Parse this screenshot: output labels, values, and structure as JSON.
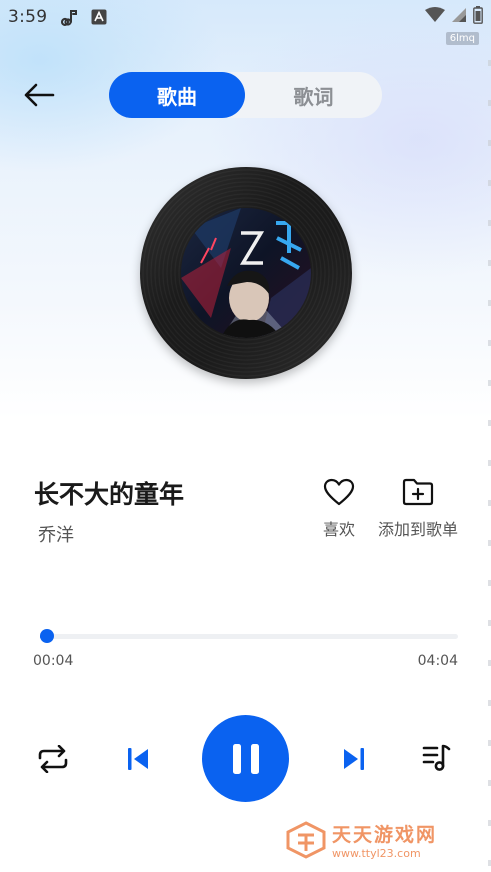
{
  "status_bar": {
    "time": "3:59",
    "icons": [
      "music-note-icon",
      "font-a-icon"
    ],
    "right_icons": [
      "wifi-icon",
      "signal-icon",
      "battery-icon"
    ],
    "net_badge": "6lmq"
  },
  "header": {
    "back_icon": "arrow-left-icon",
    "tabs": [
      {
        "label": "歌曲",
        "active": true
      },
      {
        "label": "歌词",
        "active": false
      }
    ]
  },
  "disc": {
    "cover_icon": "album-cover-image"
  },
  "song": {
    "title": "长不大的童年",
    "artist": "乔洋"
  },
  "actions": {
    "like_label": "喜欢",
    "add_label": "添加到歌单"
  },
  "progress": {
    "current": "00:04",
    "total": "04:04",
    "fraction": 0.016
  },
  "controls": {
    "repeat_icon": "repeat-icon",
    "prev_icon": "skip-previous-icon",
    "play_state": "playing",
    "next_icon": "skip-next-icon",
    "playlist_icon": "playlist-icon"
  },
  "colors": {
    "accent": "#0a62f0"
  },
  "watermark": {
    "name": "天天游戏网",
    "url": "www.ttyl23.com"
  }
}
